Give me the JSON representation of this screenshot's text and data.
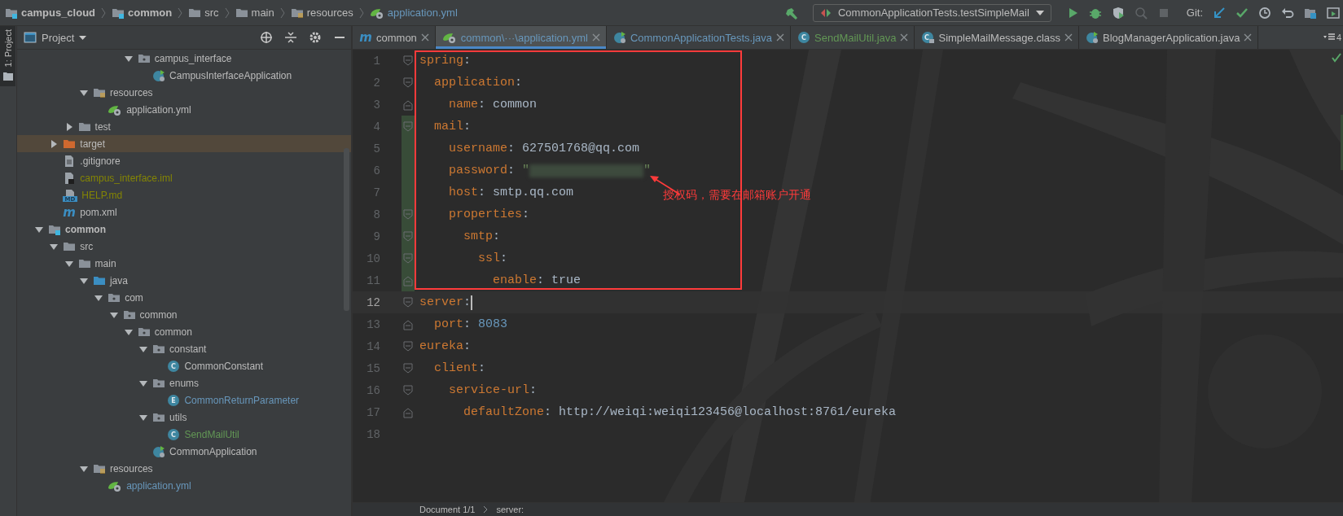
{
  "breadcrumbs": [
    {
      "label": "campus_cloud",
      "kind": "module"
    },
    {
      "label": "common",
      "kind": "module"
    },
    {
      "label": "src",
      "kind": "folder"
    },
    {
      "label": "main",
      "kind": "folder"
    },
    {
      "label": "resources",
      "kind": "resources"
    },
    {
      "label": "application.yml",
      "kind": "yml"
    }
  ],
  "toolbar": [
    {
      "kind": "build",
      "disabled": false
    },
    {
      "kind": "run_config",
      "label": "CommonApplicationTests.testSimpleMail"
    },
    {
      "kind": "run",
      "disabled": false
    },
    {
      "kind": "debug",
      "disabled": false
    },
    {
      "kind": "coverage",
      "disabled": false
    },
    {
      "kind": "profile",
      "disabled": true
    },
    {
      "kind": "stop",
      "disabled": true
    },
    {
      "kind": "label",
      "label": "Git:"
    },
    {
      "kind": "vcs_update",
      "disabled": false
    },
    {
      "kind": "vcs_commit",
      "disabled": false
    },
    {
      "kind": "history",
      "disabled": false
    },
    {
      "kind": "rollback",
      "disabled": false
    },
    {
      "kind": "project_structure",
      "disabled": false
    },
    {
      "kind": "presentation",
      "disabled": false
    }
  ],
  "side_strip": {
    "label": "1: Project",
    "selected": true
  },
  "project_panel": {
    "title": "Project",
    "tree": [
      {
        "children": [
          {
            "children": [
              {
                "children": [
                  {
                    "children": [
                      {
                        "children": [
                          {
                            "children": [
                              {
                                "label": "campus_interface",
                                "kind": "package",
                                "expanded": true,
                                "selected": false,
                                "color": "#bbbbbb",
                                "children": [
                                  {
                                    "label": "CampusInterfaceApplication",
                                    "kind": "spring_class",
                                    "selected": false,
                                    "color": "#bbbbbb"
                                  }
                                ]
                              }
                            ]
                          }
                        ]
                      }
                    ]
                  },
                  {
                    "label": "resources",
                    "kind": "resources",
                    "expanded": true,
                    "selected": false,
                    "color": "#bbbbbb",
                    "children": [
                      {
                        "label": "application.yml",
                        "kind": "yml",
                        "selected": false,
                        "color": "#bbbbbb"
                      }
                    ]
                  }
                ]
              },
              {
                "label": "test",
                "kind": "folder",
                "expanded": false,
                "selected": false,
                "color": "#bbbbbb"
              }
            ]
          },
          {
            "label": "target",
            "kind": "excluded",
            "expanded": false,
            "selected": true,
            "color": "#bbbbbb"
          },
          {
            "label": ".gitignore",
            "kind": "file",
            "selected": false,
            "color": "#bbbbbb"
          },
          {
            "label": "campus_interface.iml",
            "kind": "iml",
            "selected": false,
            "color": "#848504"
          },
          {
            "label": "HELP.md",
            "kind": "md",
            "letter": "MD",
            "selected": false,
            "color": "#848504"
          },
          {
            "label": "pom.xml",
            "kind": "maven",
            "letter": "m",
            "selected": false,
            "color": "#bbbbbb"
          }
        ]
      },
      {
        "label": "common",
        "kind": "module",
        "expanded": true,
        "selected": false,
        "color": "#bbbbbb",
        "children": [
          {
            "label": "src",
            "kind": "folder",
            "expanded": true,
            "selected": false,
            "color": "#bbbbbb",
            "children": [
              {
                "label": "main",
                "kind": "folder",
                "expanded": true,
                "selected": false,
                "color": "#bbbbbb",
                "children": [
                  {
                    "label": "java",
                    "kind": "source",
                    "expanded": true,
                    "selected": false,
                    "color": "#bbbbbb",
                    "children": [
                      {
                        "label": "com",
                        "kind": "package",
                        "expanded": true,
                        "selected": false,
                        "color": "#bbbbbb",
                        "children": [
                          {
                            "label": "common",
                            "kind": "package",
                            "expanded": true,
                            "selected": false,
                            "color": "#bbbbbb",
                            "children": [
                              {
                                "label": "common",
                                "kind": "package",
                                "expanded": true,
                                "selected": false,
                                "color": "#bbbbbb",
                                "children": [
                                  {
                                    "label": "constant",
                                    "kind": "package",
                                    "expanded": true,
                                    "selected": false,
                                    "color": "#bbbbbb",
                                    "children": [
                                      {
                                        "label": "CommonConstant",
                                        "kind": "class",
                                        "letter": "C",
                                        "selected": false,
                                        "color": "#bbbbbb"
                                      }
                                    ]
                                  },
                                  {
                                    "label": "enums",
                                    "kind": "package",
                                    "expanded": true,
                                    "selected": false,
                                    "color": "#bbbbbb",
                                    "children": [
                                      {
                                        "label": "CommonReturnParameter",
                                        "kind": "class",
                                        "letter": "E",
                                        "selected": false,
                                        "color": "#6897bb"
                                      }
                                    ]
                                  },
                                  {
                                    "label": "utils",
                                    "kind": "package",
                                    "expanded": true,
                                    "selected": false,
                                    "color": "#bbbbbb",
                                    "children": [
                                      {
                                        "label": "SendMailUtil",
                                        "kind": "class",
                                        "letter": "C",
                                        "selected": false,
                                        "color": "#629755"
                                      }
                                    ]
                                  },
                                  {
                                    "label": "CommonApplication",
                                    "kind": "spring_class",
                                    "selected": false,
                                    "color": "#bbbbbb"
                                  }
                                ]
                              }
                            ]
                          }
                        ]
                      }
                    ]
                  },
                  {
                    "label": "resources",
                    "kind": "resources",
                    "expanded": true,
                    "selected": false,
                    "color": "#bbbbbb",
                    "children": [
                      {
                        "label": "application.yml",
                        "kind": "yml",
                        "selected": false,
                        "color": "#6897bb"
                      }
                    ]
                  }
                ]
              }
            ]
          }
        ]
      }
    ]
  },
  "editor": {
    "tabs": [
      {
        "label": "common",
        "kind": "maven",
        "letter": "m",
        "selected": false,
        "color": "#bbbbbb"
      },
      {
        "label": "common\\···\\application.yml",
        "kind": "yml",
        "selected": true,
        "color": "#6897bb"
      },
      {
        "label": "CommonApplicationTests.java",
        "kind": "spring_class",
        "selected": false,
        "color": "#6897bb"
      },
      {
        "label": "SendMailUtil.java",
        "kind": "class",
        "letter": "C",
        "selected": false,
        "color": "#629755"
      },
      {
        "label": "SimpleMailMessage.class",
        "kind": "locked_class",
        "letter": "C",
        "selected": false,
        "color": "#bbbbbb"
      },
      {
        "label": "BlogManagerApplication.java",
        "kind": "spring_class",
        "selected": false,
        "color": "#bbbbbb"
      }
    ],
    "overflow": "4",
    "lines": [
      {
        "number": "1",
        "key": "spring",
        "sep": ":",
        "fold_start": true,
        "fold_end": false,
        "changed": false,
        "current": false
      },
      {
        "number": "2",
        "key": "  application",
        "sep": ":",
        "fold_start": true,
        "fold_end": false,
        "changed": false,
        "current": false
      },
      {
        "number": "3",
        "key": "    name",
        "sep": ": ",
        "value": {
          "text": "common",
          "color": "#a9b7c6"
        },
        "fold_start": false,
        "fold_end": true,
        "changed": false,
        "current": false
      },
      {
        "number": "4",
        "key": "  mail",
        "sep": ":",
        "fold_start": true,
        "fold_end": false,
        "changed": true,
        "current": false
      },
      {
        "number": "5",
        "key": "    username",
        "sep": ": ",
        "value": {
          "text": "627501768@qq.com",
          "color": "#a9b7c6"
        },
        "fold_start": false,
        "fold_end": false,
        "changed": true,
        "current": false
      },
      {
        "number": "6",
        "key": "    password",
        "sep": ": ",
        "value": {
          "text": "\"",
          "color": "#6a8759"
        },
        "redacted": true,
        "value_end": {
          "text": "\"",
          "color": "#6a8759"
        },
        "fold_start": false,
        "fold_end": false,
        "changed": true,
        "current": false
      },
      {
        "number": "7",
        "key": "    host",
        "sep": ": ",
        "value": {
          "text": "smtp.qq.com",
          "color": "#a9b7c6"
        },
        "fold_start": false,
        "fold_end": false,
        "changed": true,
        "current": false
      },
      {
        "number": "8",
        "key": "    properties",
        "sep": ":",
        "fold_start": true,
        "fold_end": false,
        "changed": true,
        "current": false
      },
      {
        "number": "9",
        "key": "      smtp",
        "sep": ":",
        "fold_start": true,
        "fold_end": false,
        "changed": true,
        "current": false
      },
      {
        "number": "10",
        "key": "        ssl",
        "sep": ":",
        "fold_start": true,
        "fold_end": false,
        "changed": true,
        "current": false
      },
      {
        "number": "11",
        "key": "          enable",
        "sep": ": ",
        "value": {
          "text": "true",
          "color": "#a9b7c6"
        },
        "fold_start": false,
        "fold_end": true,
        "changed": true,
        "current": false
      },
      {
        "number": "12",
        "key": "server",
        "sep": ":",
        "fold_start": true,
        "fold_end": false,
        "changed": false,
        "current": true
      },
      {
        "number": "13",
        "key": "  port",
        "sep": ": ",
        "value": {
          "text": "8083",
          "color": "#6897bb"
        },
        "fold_start": false,
        "fold_end": true,
        "changed": false,
        "current": false
      },
      {
        "number": "14",
        "key": "eureka",
        "sep": ":",
        "fold_start": true,
        "fold_end": false,
        "changed": false,
        "current": false
      },
      {
        "number": "15",
        "key": "  client",
        "sep": ":",
        "fold_start": true,
        "fold_end": false,
        "changed": false,
        "current": false
      },
      {
        "number": "16",
        "key": "    service-url",
        "sep": ":",
        "fold_start": true,
        "fold_end": false,
        "changed": false,
        "current": false
      },
      {
        "number": "17",
        "key": "      defaultZone",
        "sep": ": ",
        "value": {
          "text": "http://weiqi:weiqi123456@localhost:8761/eureka",
          "color": "#a9b7c6"
        },
        "fold_start": false,
        "fold_end": true,
        "changed": false,
        "current": false
      },
      {
        "number": "18",
        "fold_start": false,
        "fold_end": false,
        "changed": false,
        "current": false
      }
    ],
    "annotation": {
      "text": "授权码，需要在邮箱账户开通"
    },
    "status": [
      "Document 1/1",
      "server:"
    ]
  }
}
